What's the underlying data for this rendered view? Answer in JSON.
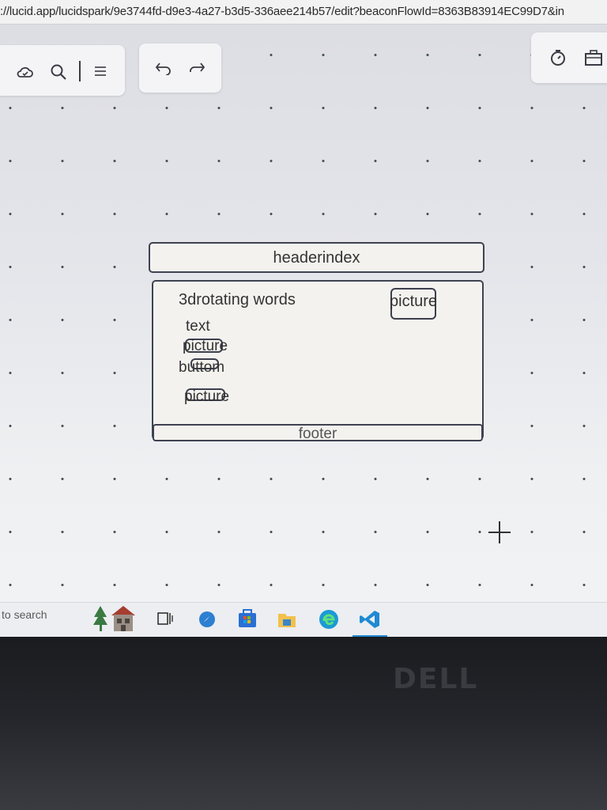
{
  "browser": {
    "url": "://lucid.app/lucidspark/9e3744fd-d9e3-4a27-b3d5-336aee214b57/edit?beaconFlowId=8363B83914EC99D7&in"
  },
  "toolbar_left": {
    "icons": [
      "cloud-save-icon",
      "search-icon",
      "menu-icon"
    ]
  },
  "toolbar_history": {
    "icons": [
      "undo-icon",
      "redo-icon"
    ]
  },
  "toolbar_right": {
    "icons": [
      "timer-icon",
      "present-icon"
    ]
  },
  "diagram": {
    "header_label": "headerindex",
    "title_label": "3drotating words",
    "text_label": "text",
    "picture_label_1": "picture",
    "button_label": "buttom",
    "picture_label_2": "picture",
    "picture_label_right": "picture",
    "footer_label": "footer"
  },
  "taskbar": {
    "search_text": "to search",
    "apps": [
      "tree-widget-icon",
      "house-widget-icon",
      "task-view-icon",
      "chrome-like-icon",
      "store-icon",
      "file-explorer-icon",
      "edge-icon",
      "vscode-icon"
    ]
  },
  "laptop": {
    "brand": "DELL"
  }
}
